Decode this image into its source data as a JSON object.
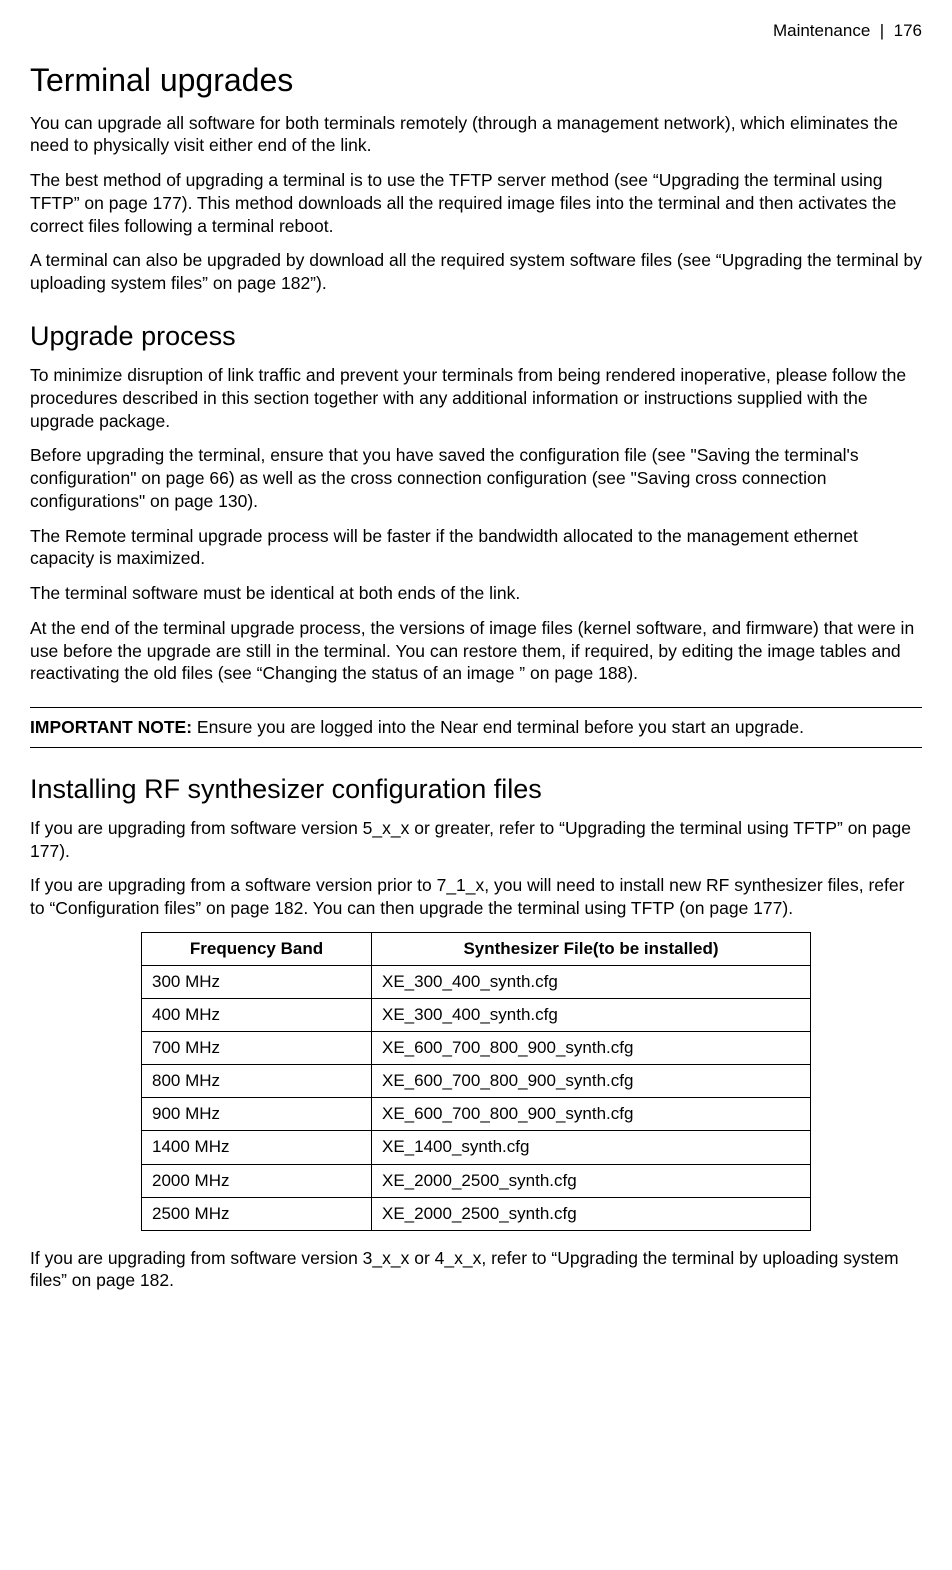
{
  "header": {
    "section": "Maintenance",
    "sep": "|",
    "page": "176"
  },
  "h1": "Terminal upgrades",
  "p1": "You can upgrade all software for both terminals remotely (through a management network), which eliminates the need to physically visit either end of the link.",
  "p2": "The best method of upgrading a terminal is to use the TFTP server method (see “Upgrading the terminal using TFTP” on page 177). This method downloads all the required image files into the terminal and then activates the correct files following a terminal reboot.",
  "p3": "A terminal can also be upgraded by download all the required system software files (see “Upgrading the terminal by uploading system files” on page 182”).",
  "h2a": "Upgrade process",
  "p4": "To minimize disruption of link traffic and prevent your terminals from being rendered inoperative, please follow the procedures described in this section together with any additional information or instructions supplied with the upgrade package.",
  "p5": "Before upgrading the terminal, ensure that you have saved the configuration file (see \"Saving the terminal's configuration\" on page 66) as well as the cross connection configuration (see \"Saving cross connection configurations\" on page 130).",
  "p6": "The Remote terminal upgrade process will be faster if the bandwidth allocated to the management ethernet capacity is maximized.",
  "p7": "The terminal software must be identical at both ends of the link.",
  "p8": "At the end of the terminal upgrade process, the versions of image files (kernel software, and firmware) that were in use before the upgrade are still in the terminal. You can restore them, if required, by editing the image tables and reactivating the old files (see “Changing the status of an image ” on page 188).",
  "note": {
    "label": "IMPORTANT NOTE:",
    "text": " Ensure you are logged into the Near end terminal before you start an upgrade."
  },
  "h2b": "Installing RF synthesizer configuration files",
  "p9": "If you are upgrading from software version 5_x_x or greater, refer to “Upgrading the terminal using TFTP” on page 177).",
  "p10": "If you are upgrading from a software version prior to 7_1_x, you will need to install new RF synthesizer files, refer to “Configuration files” on page 182. You can then upgrade the terminal using TFTP (on page 177).",
  "table": {
    "headers": [
      "Frequency Band",
      "Synthesizer File(to be installed)"
    ],
    "rows": [
      [
        "300 MHz",
        "XE_300_400_synth.cfg"
      ],
      [
        "400 MHz",
        "XE_300_400_synth.cfg"
      ],
      [
        "700 MHz",
        "XE_600_700_800_900_synth.cfg"
      ],
      [
        "800 MHz",
        "XE_600_700_800_900_synth.cfg"
      ],
      [
        "900 MHz",
        "XE_600_700_800_900_synth.cfg"
      ],
      [
        "1400 MHz",
        "XE_1400_synth.cfg"
      ],
      [
        "2000 MHz",
        "XE_2000_2500_synth.cfg"
      ],
      [
        "2500 MHz",
        "XE_2000_2500_synth.cfg"
      ]
    ]
  },
  "p11": "If you are upgrading from software version 3_x_x or 4_x_x, refer to “Upgrading the terminal by uploading system files” on page 182."
}
